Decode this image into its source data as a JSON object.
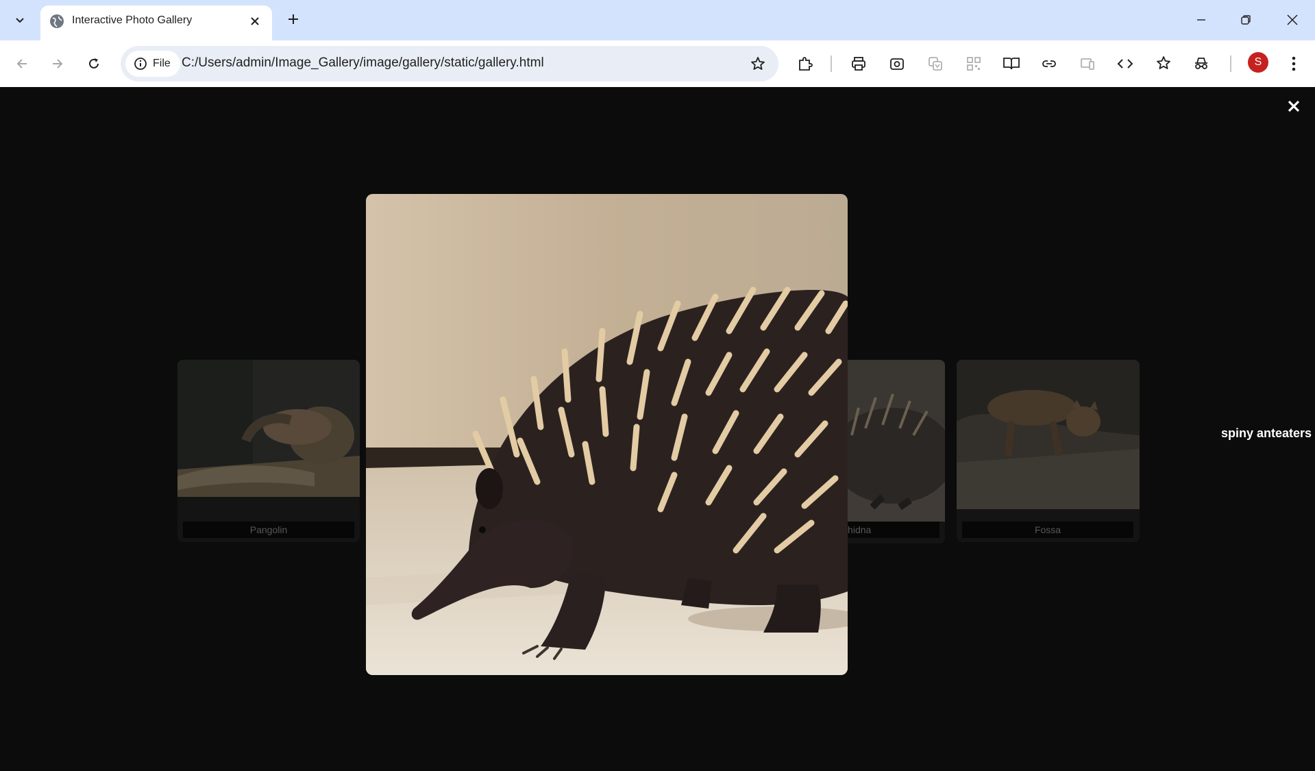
{
  "browser": {
    "tab_title": "Interactive Photo Gallery",
    "omnibox_chip": "File",
    "url": "C:/Users/admin/Image_Gallery/image/gallery/static/gallery.html",
    "profile_initial": "S"
  },
  "gallery": {
    "cards": [
      {
        "caption": "Pangolin"
      },
      {
        "caption": "Echidna"
      },
      {
        "caption": "Fossa"
      }
    ],
    "lightbox": {
      "caption": "spiny anteaters"
    }
  },
  "colors": {
    "tabstrip": "#d3e3fd",
    "page_background": "#0c0c0c",
    "avatar": "#c5221f"
  }
}
